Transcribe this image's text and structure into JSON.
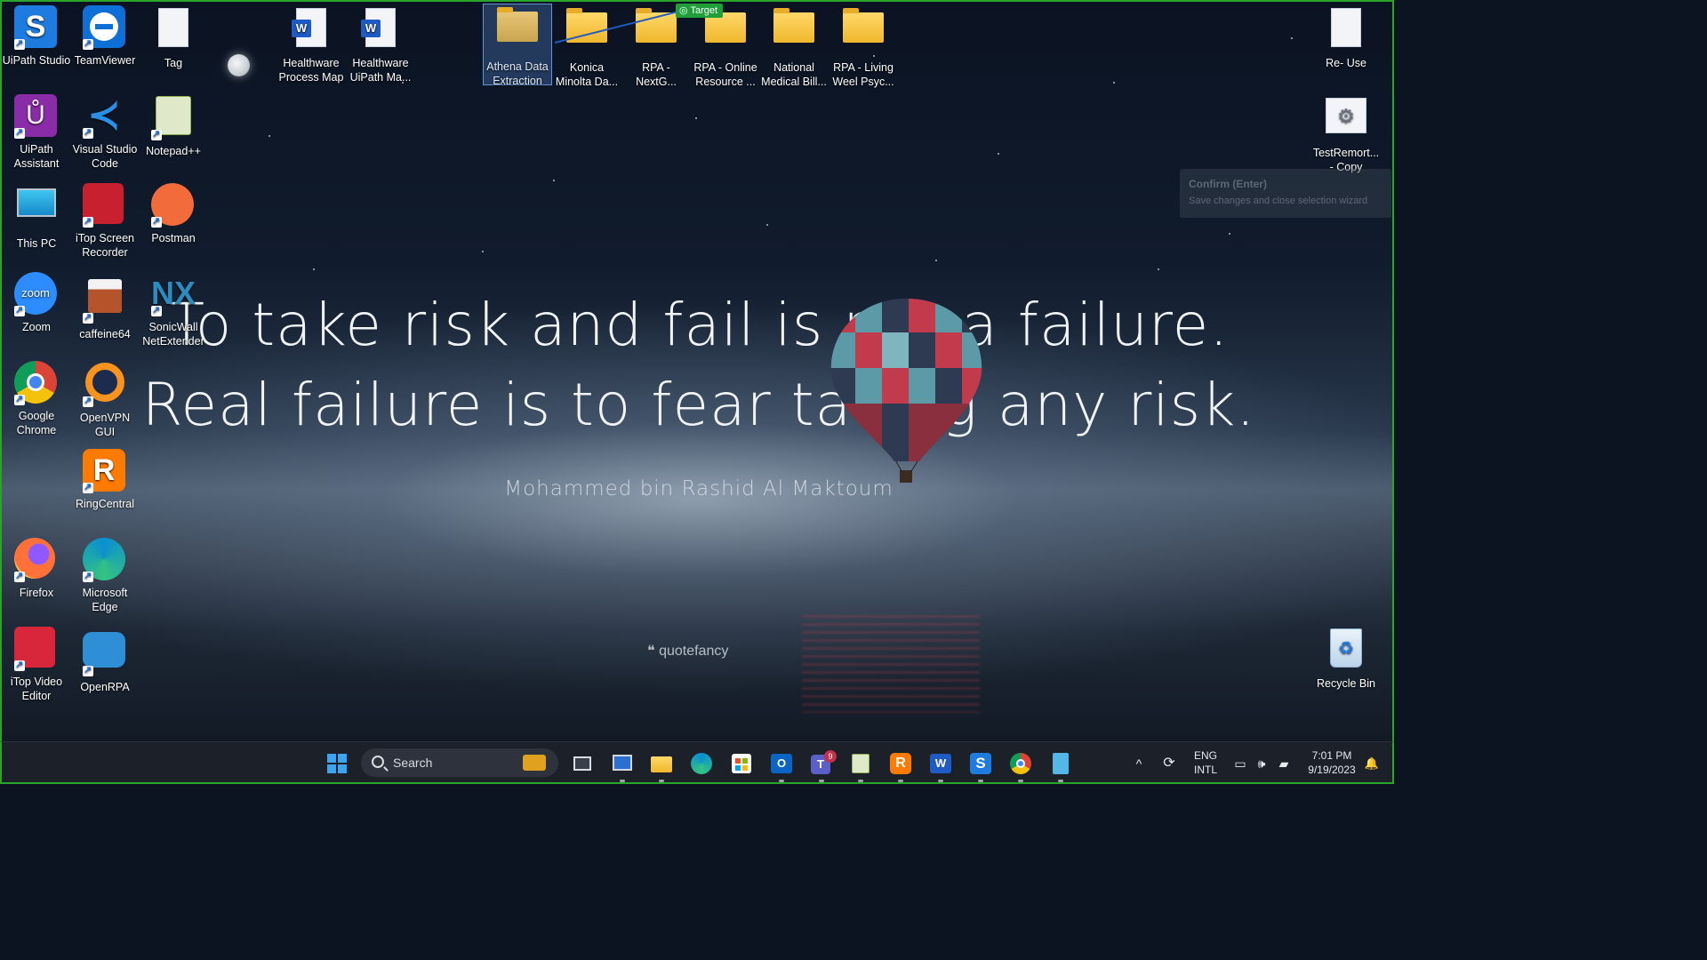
{
  "desktop": {
    "icons_left": [
      {
        "label": "UiPath Studio"
      },
      {
        "label": "TeamViewer"
      },
      {
        "label": "Tag"
      },
      {
        "label": "UiPath Assistant"
      },
      {
        "label": "Visual Studio Code"
      },
      {
        "label": "Notepad++"
      },
      {
        "label": "This PC"
      },
      {
        "label": "iTop Screen Recorder"
      },
      {
        "label": "Postman"
      },
      {
        "label": "Zoom"
      },
      {
        "label": "caffeine64"
      },
      {
        "label": "SonicWall NetExtender"
      },
      {
        "label": "Google Chrome"
      },
      {
        "label": "OpenVPN GUI"
      },
      {
        "label": "RingCentral"
      },
      {
        "label": "Firefox"
      },
      {
        "label": "Microsoft Edge"
      },
      {
        "label": "iTop Video Editor"
      },
      {
        "label": "OpenRPA"
      }
    ],
    "icons_top": [
      {
        "label": "Healthware Process Map"
      },
      {
        "label": "Healthware UiPath Ma..."
      },
      {
        "label": "Athena Data Extraction"
      },
      {
        "label": "Konica Minolta Da..."
      },
      {
        "label": "RPA - NextG..."
      },
      {
        "label": "RPA - Online Resource ..."
      },
      {
        "label": "National Medical Bill..."
      },
      {
        "label": "RPA - Living Weel Psyc..."
      }
    ],
    "icons_right": [
      {
        "label": "Re- Use"
      },
      {
        "label": "TestRemort... - Copy"
      },
      {
        "label": "Recycle Bin"
      }
    ],
    "target_badge": "Target",
    "tooltip": {
      "title": "Confirm (Enter)",
      "desc": "Save changes and close selection wizard"
    }
  },
  "wallpaper": {
    "line1": "To take risk and fail is not a failure.",
    "line2": "Real failure is to fear taking any risk.",
    "author": "Mohammed bin Rashid Al Maktoum",
    "brand": "quotefancy"
  },
  "taskbar": {
    "search_label": "Search",
    "language": "ENG",
    "layout": "INTL",
    "time": "7:01 PM",
    "date": "9/19/2023",
    "teams_badge": "9"
  },
  "colors": {
    "highlight_border": "#2aa52a",
    "taskbar_bg": "#1c2029",
    "folder": "#f0b72d",
    "word_blue": "#1f5bc2"
  }
}
